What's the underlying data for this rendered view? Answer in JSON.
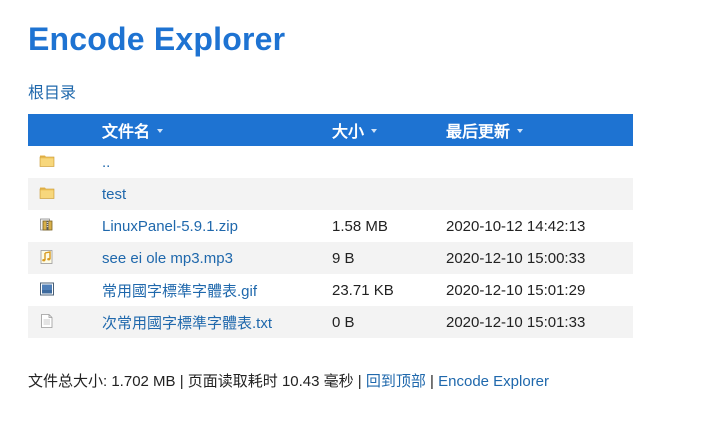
{
  "header": {
    "title": "Encode Explorer"
  },
  "breadcrumb": {
    "root": "根目录"
  },
  "table": {
    "columns": {
      "name": "文件名",
      "size": "大小",
      "modified": "最后更新"
    },
    "rows": [
      {
        "icon": "folder-icon",
        "name": "..",
        "size": "",
        "modified": ""
      },
      {
        "icon": "folder-icon",
        "name": "test",
        "size": "",
        "modified": ""
      },
      {
        "icon": "archive-icon",
        "name": "LinuxPanel-5.9.1.zip",
        "size": "1.58 MB",
        "modified": "2020-10-12 14:42:13"
      },
      {
        "icon": "audio-icon",
        "name": "see ei ole mp3.mp3",
        "size": "9 B",
        "modified": "2020-12-10 15:00:33"
      },
      {
        "icon": "image-icon",
        "name": "常用國字標準字體表.gif",
        "size": "23.71 KB",
        "modified": "2020-12-10 15:01:29"
      },
      {
        "icon": "text-file-icon",
        "name": "次常用國字標準字體表.txt",
        "size": "0 B",
        "modified": "2020-12-10 15:01:33"
      }
    ]
  },
  "footer": {
    "stats": "文件总大小: 1.702 MB | 页面读取耗时 10.43 毫秒 | ",
    "back_to_top": "回到顶部",
    "separator": " | ",
    "brand": "Encode Explorer"
  },
  "colors": {
    "accent": "#1e73d2",
    "link": "#1f68ac",
    "row_alt": "#f3f3f3"
  }
}
